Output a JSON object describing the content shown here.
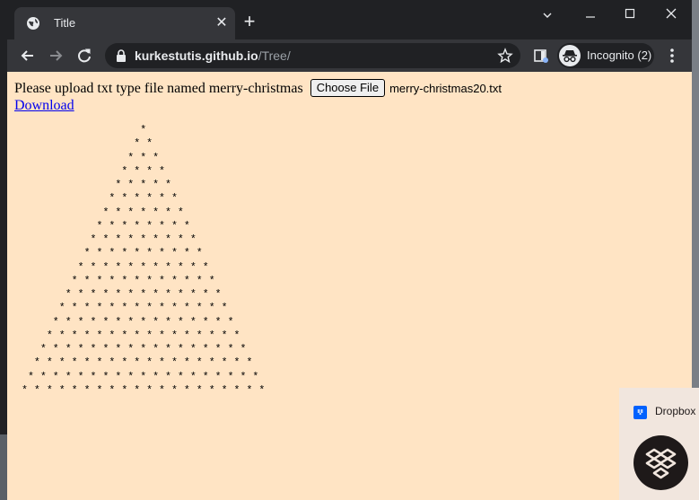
{
  "browser": {
    "tab_title": "Title",
    "tab_close": "✕",
    "new_tab": "+",
    "url_domain": "kurkestutis.github.io",
    "url_path": "/Tree/",
    "profile_label": "Incognito (2)"
  },
  "page": {
    "upload_label": "Please upload txt type file named merry-christmas",
    "choose_file_label": "Choose File",
    "selected_file": "merry-christmas20.txt",
    "download_link": "Download",
    "tree_rows": 20,
    "tree_char": "*"
  },
  "dropbox": {
    "label": "Dropbox"
  },
  "colors": {
    "page_background": "#ffe4c4",
    "chrome_dark": "#202124",
    "chrome_toolbar": "#35363a",
    "link": "#0000ee",
    "dropbox_blue": "#0061fe"
  },
  "icons": {
    "tab_favicon": "globe-icon",
    "minimize": "minimize-icon",
    "maximize": "maximize-icon",
    "close": "close-icon",
    "back": "back-arrow-icon",
    "forward": "forward-arrow-icon",
    "reload": "reload-icon",
    "lock": "lock-icon",
    "bookmark": "star-icon",
    "extension": "side-panel-icon",
    "incognito": "incognito-icon",
    "menu": "kebab-menu-icon"
  }
}
